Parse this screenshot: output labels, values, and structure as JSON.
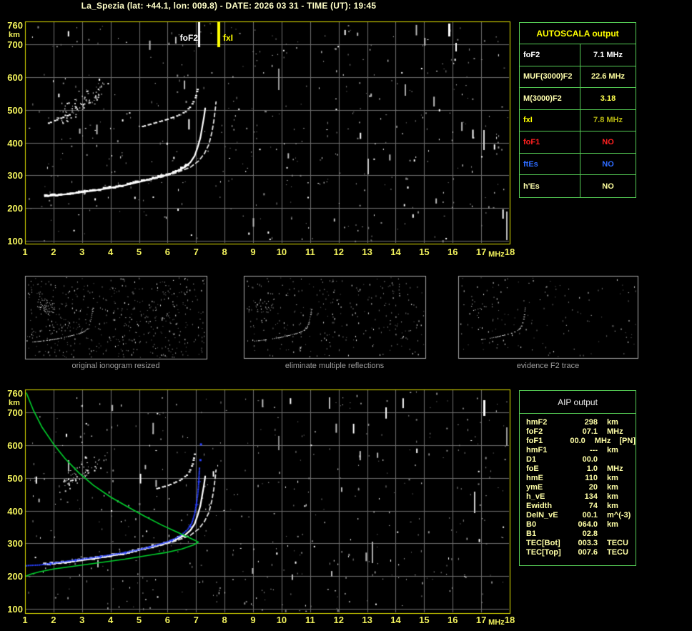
{
  "title": "La_Spezia (lat: +44.1, lon: 009.8) - DATE: 2026 03 31 - TIME (UT): 19:45",
  "colors": {
    "background": "#000000",
    "title": "#ffffc8",
    "axis_labels": "#f2f25c",
    "plot_border": "#e0e000",
    "grid": "#6e6e6e",
    "trace_white": "#ffffff",
    "profile_green": "#00d22c",
    "autoscaled_blue": "#2840ff",
    "marker_foF2": "#ffffff",
    "marker_fxI": "#ffff00",
    "table_border": "#55cc55",
    "caption_gray": "#9c9c9c"
  },
  "plots": {
    "top": {
      "xticks": [
        1,
        2,
        3,
        4,
        5,
        6,
        7,
        8,
        9,
        10,
        11,
        12,
        13,
        14,
        15,
        16,
        17,
        18
      ],
      "yticks": [
        760,
        700,
        600,
        500,
        400,
        300,
        200,
        100
      ],
      "x_unit": "MHz",
      "y_unit": "km",
      "markers": {
        "foF2": {
          "label": "foF2",
          "freq": 7.1
        },
        "fxI": {
          "label": "fxI",
          "freq": 7.8
        }
      }
    },
    "bottom": {
      "xticks": [
        1,
        2,
        3,
        4,
        5,
        6,
        7,
        8,
        9,
        10,
        11,
        12,
        13,
        14,
        15,
        16,
        17,
        18
      ],
      "yticks": [
        760,
        700,
        600,
        500,
        400,
        300,
        200,
        100
      ],
      "x_unit": "MHz",
      "y_unit": "km"
    }
  },
  "autoscala": {
    "title": "AUTOSCALA output",
    "rows": [
      {
        "label": "foF2",
        "value": "7.1 MHz",
        "label_color": "#ffffff",
        "value_color": "#ffffff"
      },
      {
        "label": "MUF(3000)F2",
        "value": "22.6 MHz",
        "label_color": "#ffffae",
        "value_color": "#ffff9e"
      },
      {
        "label": "M(3000)F2",
        "value": "3.18",
        "label_color": "#ffffae",
        "value_color": "#ffff4f"
      },
      {
        "label": "fxI",
        "value": "7.8 MHz",
        "label_color": "#ffff00",
        "value_color": "#b9b912"
      },
      {
        "label": "foF1",
        "value": "NO",
        "label_color": "#ff2020",
        "value_color": "#ff2020"
      },
      {
        "label": "ftEs",
        "value": "NO",
        "label_color": "#2e6bff",
        "value_color": "#2e6bff"
      },
      {
        "label": "h'Es",
        "value": "NO",
        "label_color": "#ffffae",
        "value_color": "#ffff9e"
      }
    ]
  },
  "thumbnails": [
    {
      "caption": "original ionogram resized"
    },
    {
      "caption": "eliminate multiple reflections"
    },
    {
      "caption": "evidence F2 trace"
    }
  ],
  "aip": {
    "title": "AIP output",
    "rows": [
      {
        "label": "hmF2",
        "value": "298",
        "unit": "km",
        "extra": ""
      },
      {
        "label": "foF2",
        "value": "07.1",
        "unit": "MHz",
        "extra": ""
      },
      {
        "label": "foF1",
        "value": "00.0",
        "unit": "MHz",
        "extra": "[PN]"
      },
      {
        "label": "hmF1",
        "value": "---",
        "unit": "km",
        "extra": ""
      },
      {
        "label": "D1",
        "value": "00.0",
        "unit": "",
        "extra": ""
      },
      {
        "label": "foE",
        "value": "1.0",
        "unit": "MHz",
        "extra": ""
      },
      {
        "label": "hmE",
        "value": "110",
        "unit": "km",
        "extra": ""
      },
      {
        "label": "ymE",
        "value": "20",
        "unit": "km",
        "extra": ""
      },
      {
        "label": "h_vE",
        "value": "134",
        "unit": "km",
        "extra": ""
      },
      {
        "label": "Ewidth",
        "value": "74",
        "unit": "km",
        "extra": ""
      },
      {
        "label": "DelN_vE",
        "value": "00.1",
        "unit": "m^(-3)",
        "extra": ""
      },
      {
        "label": "B0",
        "value": "064.0",
        "unit": "km",
        "extra": ""
      },
      {
        "label": "B1",
        "value": "02.8",
        "unit": "",
        "extra": ""
      },
      {
        "label": "TEC[Bot]",
        "value": "003.3",
        "unit": "TECU",
        "extra": ""
      },
      {
        "label": "TEC[Top]",
        "value": "007.6",
        "unit": "TECU",
        "extra": ""
      }
    ]
  },
  "chart_data": [
    {
      "id": "top_ionogram",
      "type": "scatter",
      "xlabel": "MHz",
      "ylabel": "km",
      "xlim": [
        1,
        18
      ],
      "ylim": [
        100,
        760
      ],
      "grid": true,
      "annotations": {
        "foF2_MHz": 7.1,
        "fxI_MHz": 7.8
      },
      "series": [
        {
          "name": "F2 trace o-mode",
          "style": "f2_main",
          "points": [
            [
              1.7,
              236
            ],
            [
              2.0,
              239
            ],
            [
              2.5,
              243
            ],
            [
              3.0,
              249
            ],
            [
              3.5,
              255
            ],
            [
              4.0,
              262
            ],
            [
              4.5,
              270
            ],
            [
              5.0,
              280
            ],
            [
              5.5,
              291
            ],
            [
              6.0,
              302
            ],
            [
              6.3,
              312
            ],
            [
              6.6,
              325
            ],
            [
              6.8,
              340
            ],
            [
              6.95,
              360
            ],
            [
              7.05,
              385
            ],
            [
              7.15,
              415
            ],
            [
              7.22,
              450
            ],
            [
              7.28,
              480
            ],
            [
              7.32,
              505
            ]
          ]
        },
        {
          "name": "F2 trace x-mode",
          "style": "x_mode",
          "points": [
            [
              5.3,
              285
            ],
            [
              5.8,
              295
            ],
            [
              6.3,
              308
            ],
            [
              6.8,
              325
            ],
            [
              7.1,
              345
            ],
            [
              7.3,
              368
            ],
            [
              7.45,
              395
            ],
            [
              7.55,
              430
            ],
            [
              7.62,
              465
            ],
            [
              7.67,
              500
            ],
            [
              7.7,
              525
            ]
          ]
        },
        {
          "name": "second reflection",
          "style": "dashes",
          "points": [
            [
              5.1,
              452
            ],
            [
              5.5,
              462
            ],
            [
              5.9,
              472
            ],
            [
              6.3,
              484
            ],
            [
              6.6,
              497
            ],
            [
              6.8,
              515
            ],
            [
              6.95,
              540
            ],
            [
              7.02,
              565
            ]
          ]
        },
        {
          "name": "spread-F patch",
          "style": "cluster",
          "n": 80,
          "points": [
            [
              2.2,
              480
            ],
            [
              3.0,
              525
            ],
            [
              3.7,
              565
            ]
          ]
        },
        {
          "name": "low diagonal streak",
          "style": "dashes",
          "points": [
            [
              1.8,
              462
            ],
            [
              2.6,
              490
            ]
          ]
        }
      ]
    },
    {
      "id": "bottom_ionogram",
      "type": "scatter",
      "xlabel": "MHz",
      "ylabel": "km",
      "xlim": [
        1,
        18
      ],
      "ylim": [
        100,
        760
      ],
      "grid": true,
      "series": [
        {
          "name": "F2 trace o-mode",
          "style": "f2_main",
          "points": [
            [
              1.7,
              236
            ],
            [
              2.0,
              239
            ],
            [
              2.5,
              243
            ],
            [
              3.0,
              249
            ],
            [
              3.5,
              255
            ],
            [
              4.0,
              262
            ],
            [
              4.5,
              270
            ],
            [
              5.0,
              280
            ],
            [
              5.5,
              291
            ],
            [
              6.0,
              302
            ],
            [
              6.3,
              312
            ],
            [
              6.6,
              325
            ],
            [
              6.8,
              340
            ],
            [
              6.95,
              360
            ],
            [
              7.05,
              385
            ],
            [
              7.15,
              415
            ],
            [
              7.22,
              450
            ],
            [
              7.28,
              480
            ],
            [
              7.32,
              505
            ]
          ]
        },
        {
          "name": "F2 trace x-mode",
          "style": "x_mode",
          "points": [
            [
              5.3,
              285
            ],
            [
              5.8,
              295
            ],
            [
              6.3,
              308
            ],
            [
              6.8,
              325
            ],
            [
              7.1,
              345
            ],
            [
              7.3,
              368
            ],
            [
              7.45,
              395
            ],
            [
              7.55,
              430
            ],
            [
              7.62,
              465
            ],
            [
              7.67,
              500
            ],
            [
              7.7,
              525
            ]
          ]
        },
        {
          "name": "second reflection remnant",
          "style": "dashes",
          "points": [
            [
              5.6,
              470
            ],
            [
              6.0,
              480
            ],
            [
              6.4,
              495
            ],
            [
              6.7,
              515
            ],
            [
              6.85,
              545
            ],
            [
              6.92,
              575
            ]
          ]
        },
        {
          "name": "spread-F patch",
          "style": "cluster",
          "n": 65,
          "points": [
            [
              2.3,
              480
            ],
            [
              3.0,
              525
            ],
            [
              3.7,
              565
            ]
          ]
        },
        {
          "name": "autoscaled F2 trace",
          "style": "blue_dots",
          "points": [
            [
              1.0,
              232
            ],
            [
              1.5,
              234
            ],
            [
              2.0,
              240
            ],
            [
              2.5,
              246
            ],
            [
              3.0,
              252
            ],
            [
              3.5,
              258
            ],
            [
              4.0,
              265
            ],
            [
              4.5,
              272
            ],
            [
              5.0,
              281
            ],
            [
              5.5,
              292
            ],
            [
              6.0,
              305
            ],
            [
              6.3,
              316
            ],
            [
              6.5,
              327
            ],
            [
              6.7,
              342
            ],
            [
              6.85,
              362
            ],
            [
              6.95,
              390
            ],
            [
              7.0,
              415
            ],
            [
              7.05,
              445
            ],
            [
              7.08,
              470
            ],
            [
              7.1,
              500
            ],
            [
              7.12,
              530
            ]
          ]
        },
        {
          "name": "electron density profile",
          "style": "green_line",
          "points": [
            [
              1.05,
              760
            ],
            [
              1.3,
              706
            ],
            [
              1.6,
              655
            ],
            [
              2.0,
              604
            ],
            [
              2.4,
              560
            ],
            [
              2.9,
              515
            ],
            [
              3.4,
              478
            ],
            [
              4.0,
              442
            ],
            [
              4.6,
              412
            ],
            [
              5.2,
              383
            ],
            [
              5.8,
              356
            ],
            [
              6.3,
              336
            ],
            [
              6.7,
              320
            ],
            [
              6.95,
              310
            ],
            [
              7.08,
              304
            ],
            [
              6.9,
              295
            ],
            [
              6.5,
              283
            ],
            [
              6.0,
              273
            ],
            [
              5.5,
              266
            ],
            [
              5.0,
              259
            ],
            [
              4.5,
              252
            ],
            [
              4.0,
              246
            ],
            [
              3.5,
              240
            ],
            [
              3.0,
              234
            ],
            [
              2.5,
              228
            ],
            [
              2.0,
              222
            ],
            [
              1.5,
              213
            ],
            [
              1.2,
              206
            ],
            [
              1.0,
              199
            ]
          ]
        }
      ]
    }
  ]
}
